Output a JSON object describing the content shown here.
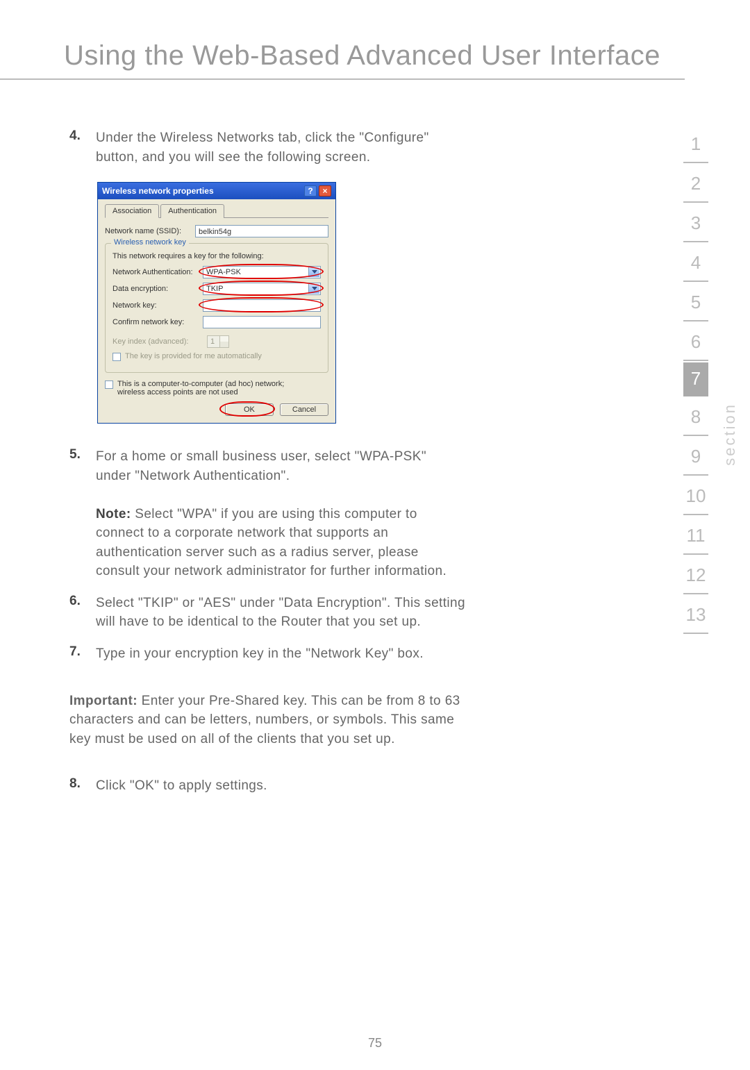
{
  "page_title": "Using the Web-Based Advanced User Interface",
  "page_number": "75",
  "section_label": "section",
  "nav": {
    "items": [
      "1",
      "2",
      "3",
      "4",
      "5",
      "6",
      "7",
      "8",
      "9",
      "10",
      "11",
      "12",
      "13"
    ],
    "active_index": 6
  },
  "steps": {
    "s4": {
      "num": "4.",
      "text": "Under the Wireless Networks tab, click the \"Configure\" button, and you will see the following screen."
    },
    "s5": {
      "num": "5.",
      "text": "For a home or small business user, select \"WPA-PSK\" under \"Network Authentication\"."
    },
    "note_label": "Note:",
    "note_text": " Select \"WPA\" if you are using this computer to connect to a corporate network that supports an authentication server such as a radius server, please consult your network administrator for further information.",
    "s6": {
      "num": "6.",
      "text": "Select \"TKIP\" or \"AES\" under \"Data Encryption\". This setting will have to be identical to the Router that you set up."
    },
    "s7": {
      "num": "7.",
      "text": "Type in your encryption key in the \"Network Key\" box."
    },
    "important_label": "Important:",
    "important_text": " Enter your Pre-Shared key. This can be from 8 to 63 characters and can be letters, numbers, or symbols. This same key must be used on all of the clients that you set up.",
    "s8": {
      "num": "8.",
      "text": "Click \"OK\" to apply settings."
    }
  },
  "dialog": {
    "title": "Wireless network properties",
    "help_glyph": "?",
    "close_glyph": "×",
    "tab_assoc": "Association",
    "tab_auth": "Authentication",
    "ssid_label": "Network name (SSID):",
    "ssid_value": "belkin54g",
    "fieldset_legend": "Wireless network key",
    "fs_intro": "This network requires a key for the following:",
    "auth_label": "Network Authentication:",
    "auth_value": "WPA-PSK",
    "enc_label": "Data encryption:",
    "enc_value": "TKIP",
    "key_label": "Network key:",
    "confirm_label": "Confirm network key:",
    "idx_label": "Key index (advanced):",
    "idx_value": "1",
    "auto_key": "The key is provided for me automatically",
    "adhoc": "This is a computer-to-computer (ad hoc) network; wireless access points are not used",
    "ok": "OK",
    "cancel": "Cancel"
  }
}
